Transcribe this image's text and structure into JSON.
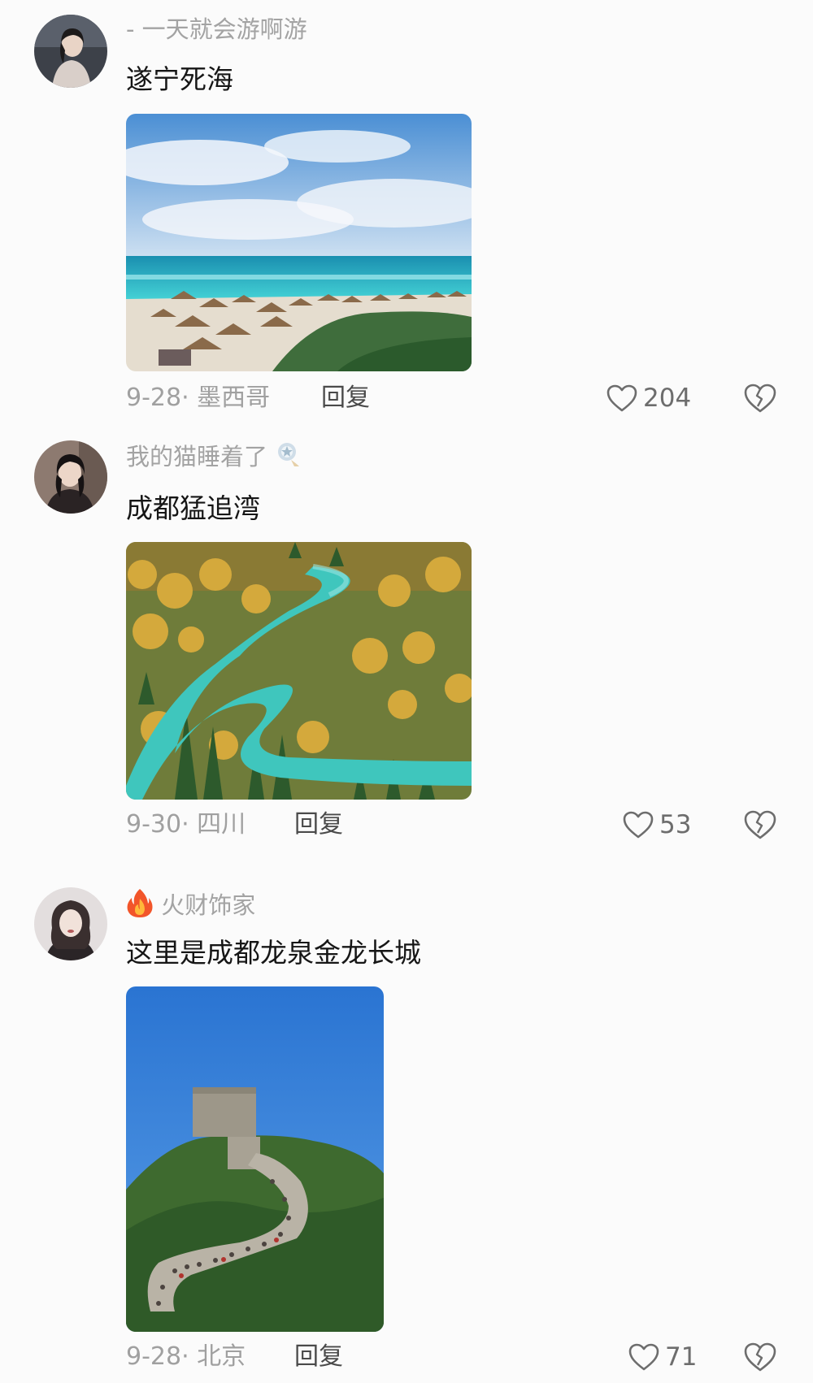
{
  "comments": [
    {
      "username": "- 一天就会游啊游",
      "text": "遂宁死海",
      "date": "9-28",
      "location": "墨西哥",
      "reply_label": "回复",
      "likes": "204",
      "avatar_icon": "user-avatar",
      "photo_subject": "beach"
    },
    {
      "username": "我的猫睡着了",
      "text": "成都猛追湾",
      "date": "9-30",
      "location": "四川",
      "reply_label": "回复",
      "likes": "53",
      "avatar_icon": "user-avatar",
      "badge_icon": "fan-badge-icon",
      "photo_subject": "river"
    },
    {
      "username": "火财饰家",
      "text": "这里是成都龙泉金龙长城",
      "date": "9-28",
      "location": "北京",
      "reply_label": "回复",
      "likes": "71",
      "avatar_icon": "user-avatar",
      "badge_icon": "fire-icon",
      "photo_subject": "great-wall"
    }
  ],
  "colors": {
    "background": "#fbfbfb",
    "username": "#a3a3a3",
    "comment_text": "#161616",
    "meta": "#a0a0a0",
    "icon": "#6d6d6d"
  }
}
